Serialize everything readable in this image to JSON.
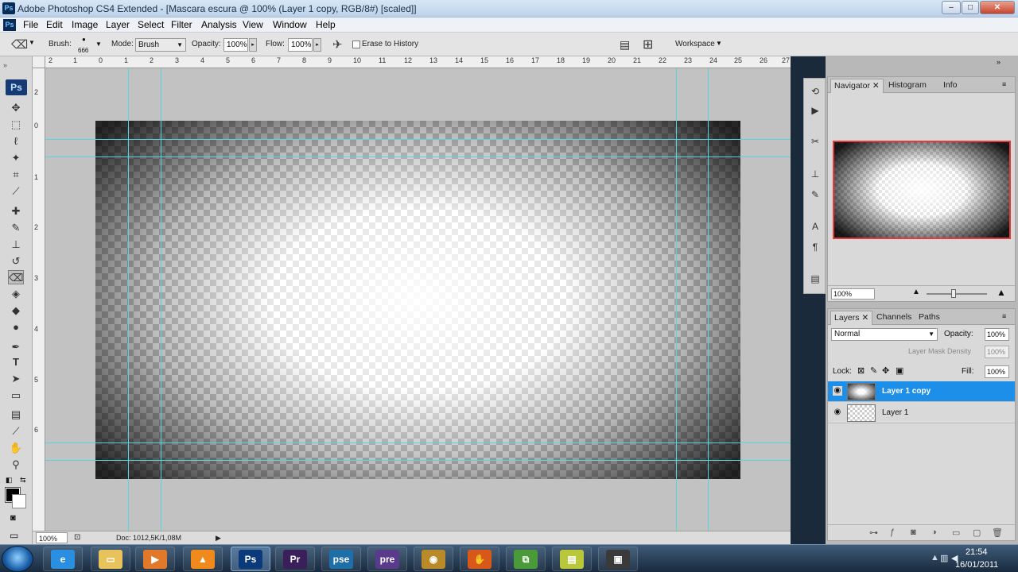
{
  "window": {
    "app_icon": "Ps",
    "title": "Adobe Photoshop CS4 Extended - [Mascara escura @ 100% (Layer 1 copy, RGB/8#) [scaled]]",
    "controls": {
      "minimize": "–",
      "maximize": "□",
      "close": "✕"
    }
  },
  "menu": {
    "items": [
      "File",
      "Edit",
      "Image",
      "Layer",
      "Select",
      "Filter",
      "Analysis",
      "View",
      "Window",
      "Help"
    ]
  },
  "options_bar": {
    "tool_icon": "eraser-icon",
    "brush_label": "Brush:",
    "brush_size": "666",
    "mode_label": "Mode:",
    "mode_value": "Brush",
    "opacity_label": "Opacity:",
    "opacity_value": "100%",
    "flow_label": "Flow:",
    "flow_value": "100%",
    "erase_history_label": "Erase to History",
    "workspace_label": "Workspace"
  },
  "toolbox": {
    "logo": "Ps",
    "tools": [
      "move",
      "marquee",
      "lasso",
      "magic-wand",
      "crop",
      "eyedropper",
      "healing",
      "brush",
      "clone-stamp",
      "history-brush",
      "eraser",
      "paint-bucket",
      "blur",
      "dodge",
      "pen",
      "type",
      "path-selection",
      "shape",
      "notes",
      "eyedropper-3d",
      "hand",
      "zoom"
    ],
    "selected_tool": "eraser",
    "foreground_color": "#000000",
    "background_color": "#ffffff"
  },
  "rulers": {
    "horizontal_labels": [
      "2",
      "1",
      "0",
      "1",
      "2",
      "3",
      "4",
      "5",
      "6",
      "7",
      "8",
      "9",
      "10",
      "11",
      "12",
      "13",
      "14",
      "15",
      "16",
      "17",
      "18",
      "19",
      "20",
      "21",
      "22",
      "23",
      "24",
      "25",
      "26",
      "27"
    ],
    "vertical_labels": [
      "2",
      "0",
      "1",
      "2",
      "3",
      "4",
      "5",
      "6"
    ]
  },
  "status_bar": {
    "zoom": "100%",
    "doc_info": "Doc: 1012,5K/1,08M"
  },
  "navigator_panel": {
    "tabs": [
      "Navigator",
      "Histogram",
      "Info"
    ],
    "active_tab": "Navigator",
    "zoom": "100%"
  },
  "layers_panel": {
    "tabs": [
      "Layers",
      "Channels",
      "Paths"
    ],
    "active_tab": "Layers",
    "blend_mode": "Normal",
    "opacity_label": "Opacity:",
    "opacity_value": "100%",
    "mask_density_label": "Layer Mask Density",
    "mask_density_value": "100%",
    "lock_label": "Lock:",
    "fill_label": "Fill:",
    "fill_value": "100%",
    "layers": [
      {
        "name": "Layer 1 copy",
        "selected": true
      },
      {
        "name": "Layer 1",
        "selected": false
      }
    ]
  },
  "taskbar": {
    "apps": [
      {
        "name": "internet-explorer",
        "glyph": "e",
        "color": "#2a8fe0"
      },
      {
        "name": "file-explorer",
        "glyph": "▭",
        "color": "#e8c25a"
      },
      {
        "name": "media-player",
        "glyph": "▶",
        "color": "#e07a2a"
      },
      {
        "name": "vlc",
        "glyph": "▲",
        "color": "#f08a1c"
      },
      {
        "name": "photoshop",
        "glyph": "Ps",
        "color": "#0b3a7a"
      },
      {
        "name": "premiere",
        "glyph": "Pr",
        "color": "#3b1f5a"
      },
      {
        "name": "photoshop-elements",
        "glyph": "pse",
        "color": "#1e6ea8"
      },
      {
        "name": "premiere-elements",
        "glyph": "pre",
        "color": "#5a3a8a"
      },
      {
        "name": "speaker-app",
        "glyph": "◉",
        "color": "#b88a2a"
      },
      {
        "name": "claw-app",
        "glyph": "✋",
        "color": "#d8581a"
      },
      {
        "name": "network-app",
        "glyph": "⧉",
        "color": "#4a9a3a"
      },
      {
        "name": "notes-app",
        "glyph": "▤",
        "color": "#b8c83a"
      },
      {
        "name": "camtasia",
        "glyph": "▣",
        "color": "#3a3a3a"
      }
    ],
    "clock_time": "21:54",
    "clock_date": "16/01/2011"
  },
  "colors": {
    "guide": "#53d6dd",
    "selected_layer": "#1e8fe8",
    "navigator_frame": "#e03c3c"
  }
}
